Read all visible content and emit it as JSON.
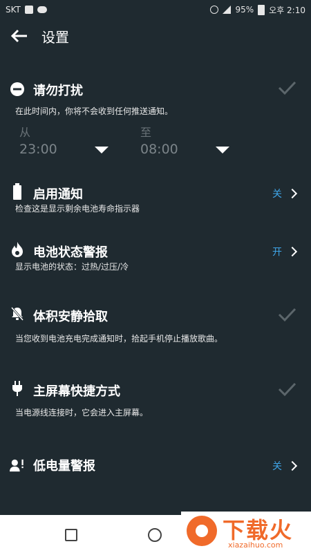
{
  "status_bar": {
    "carrier": "SKT",
    "battery": "95%",
    "time": "오후 2:10"
  },
  "toolbar": {
    "title": "设置"
  },
  "dnd": {
    "title": "请勿打扰",
    "desc": "在此时间内，你将不会收到任何推送通知。",
    "from_label": "从",
    "from_time": "23:00",
    "to_label": "至",
    "to_time": "08:00"
  },
  "items": [
    {
      "title": "启用通知",
      "desc": "检查这是显示剩余电池寿命指示器",
      "value": "关",
      "icon": "battery-icon"
    },
    {
      "title": "电池状态警报",
      "desc": "显示电池的状态：过热/过压/冷",
      "value": "开",
      "icon": "flame-icon"
    },
    {
      "title": "体积安静拾取",
      "desc": "当您收到电池充电完成通知时，拾起手机停止播放歌曲。",
      "icon": "bell-off-icon"
    },
    {
      "title": "主屏幕快捷方式",
      "desc": "当电源线连接时，它会进入主屏幕。",
      "icon": "plug-icon"
    },
    {
      "title": "低电量警报",
      "value": "关",
      "icon": "person-alert-icon"
    }
  ],
  "watermark": {
    "brand": "下载火",
    "url": "xiazaihuo.com"
  },
  "colors": {
    "background": "#1f2a30",
    "accent": "#3fa5e8",
    "check": "#5c666b"
  }
}
